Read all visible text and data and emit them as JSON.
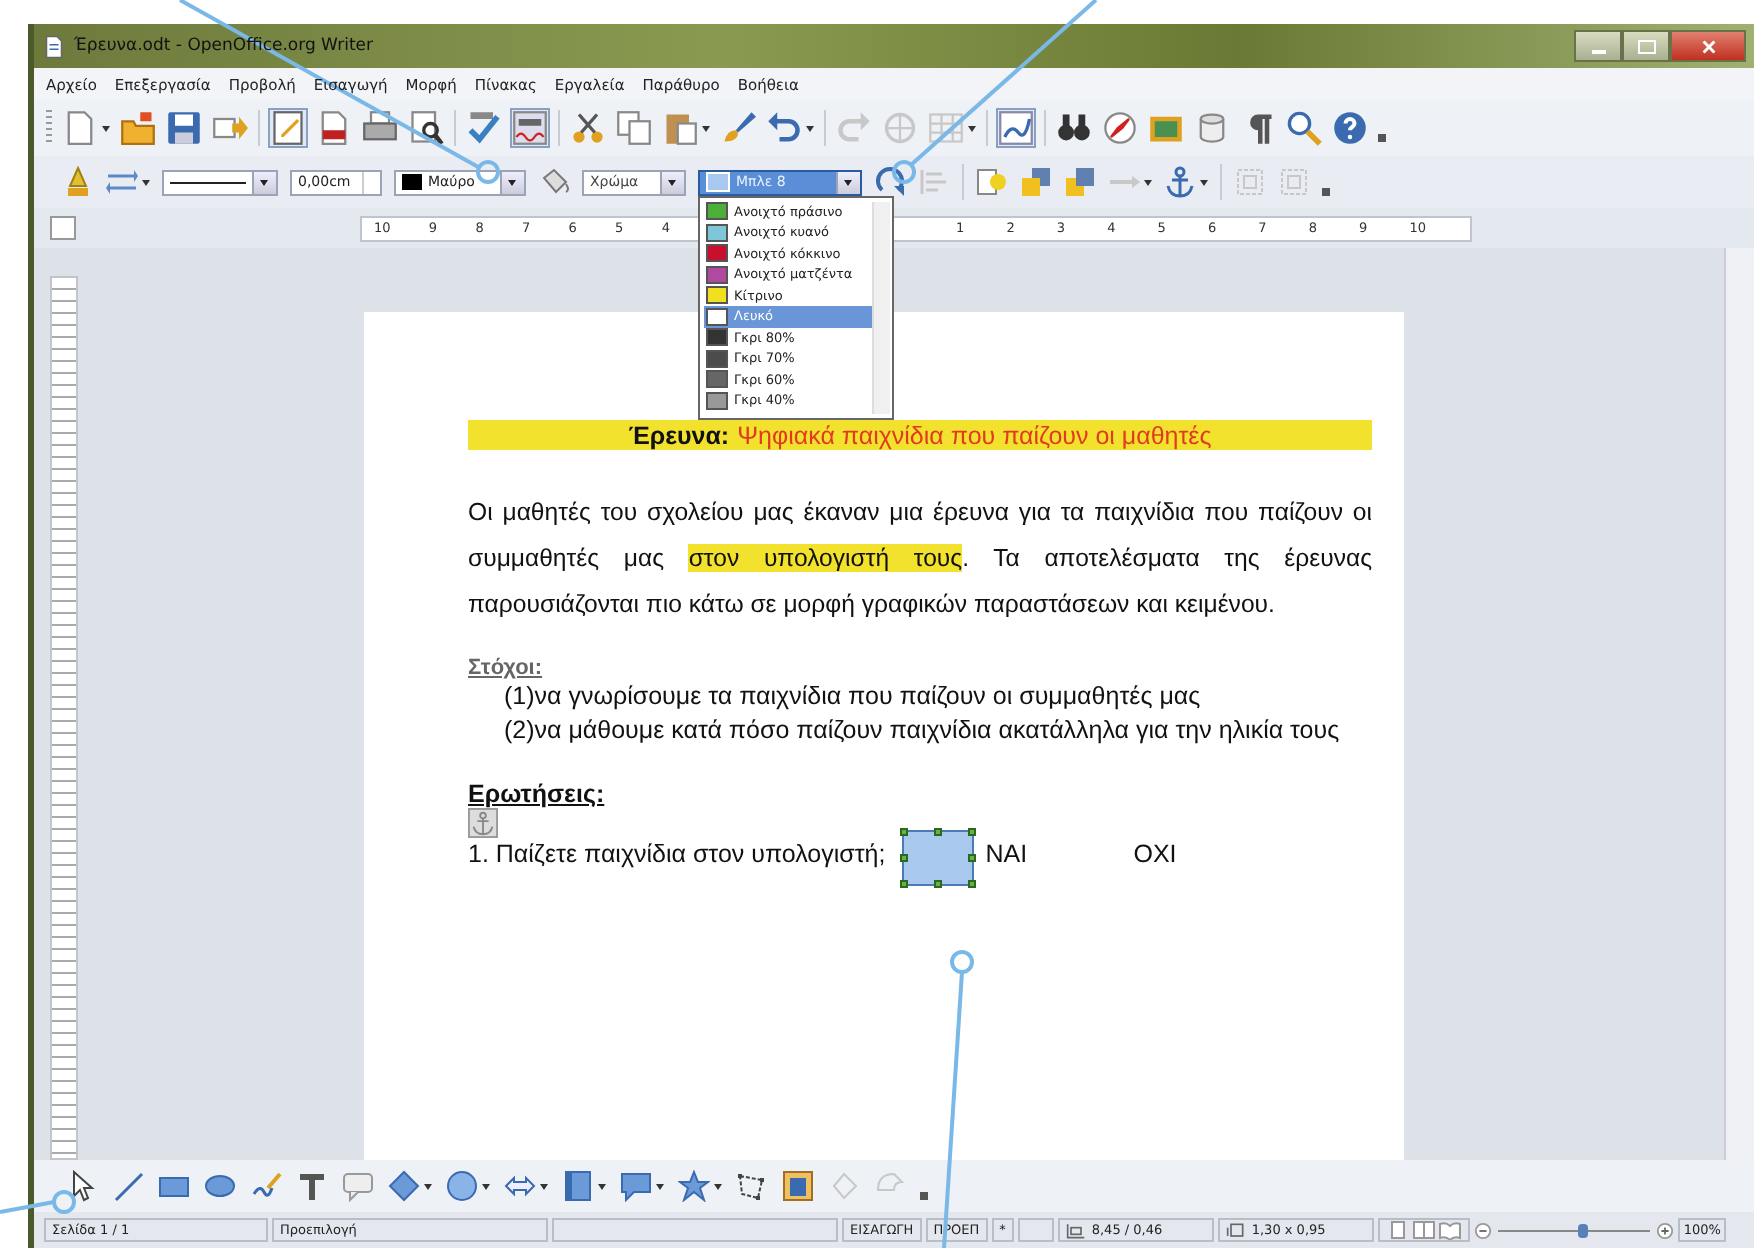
{
  "window": {
    "title": "Έρευνα.odt - OpenOffice.org Writer"
  },
  "menu": [
    "Αρχείο",
    "Επεξεργασία",
    "Προβολή",
    "Εισαγωγή",
    "Μορφή",
    "Πίνακας",
    "Εργαλεία",
    "Παράθυρο",
    "Βοήθεια"
  ],
  "drawing_properties": {
    "line_width": "0,00cm",
    "line_color": "Μαύρο",
    "area_style": "Χρώμα",
    "area_color": "Μπλε 8",
    "area_color_expanded": true
  },
  "color_list": [
    {
      "label": "Ανοιχτό πράσινο",
      "color": "#4caf3a",
      "selected": false
    },
    {
      "label": "Ανοιχτό κυανό",
      "color": "#7fc6d8",
      "selected": false
    },
    {
      "label": "Ανοιχτό κόκκινο",
      "color": "#c8102e",
      "selected": false
    },
    {
      "label": "Ανοιχτό ματζέντα",
      "color": "#b04aa0",
      "selected": false
    },
    {
      "label": "Κίτρινο",
      "color": "#f0e020",
      "selected": false
    },
    {
      "label": "Λευκό",
      "color": "#ffffff",
      "selected": true
    },
    {
      "label": "Γκρι 80%",
      "color": "#333333",
      "selected": false
    },
    {
      "label": "Γκρι 70%",
      "color": "#4c4c4c",
      "selected": false
    },
    {
      "label": "Γκρι 60%",
      "color": "#666666",
      "selected": false
    },
    {
      "label": "Γκρι 40%",
      "color": "#999999",
      "selected": false
    }
  ],
  "ruler": {
    "left_labels": [
      "10",
      "9",
      "8",
      "7",
      "6",
      "5",
      "4"
    ],
    "right_labels": [
      "1",
      "2",
      "3",
      "4",
      "5",
      "6",
      "7",
      "8",
      "9",
      "10"
    ]
  },
  "document": {
    "heading": {
      "label": "Έρευνα:",
      "title": "Ψηφιακά παιχνίδια που παίζουν οι μαθητές"
    },
    "paragraph": [
      {
        "text": "Οι μαθητές του σχολείου μας έκαναν μια έρευνα για τα παιχνίδια που παίζουν οι συμμαθητές μας ",
        "highlighted": false
      },
      {
        "text": "στον υπολογιστή τους",
        "highlighted": true
      },
      {
        "text": ". Τα αποτελέσματα της έρευνας παρουσιάζονται πιο κάτω σε μορφή γραφικών παραστάσεων και κειμένου.",
        "highlighted": false
      }
    ],
    "goals_heading": "Στόχοι:",
    "goals": [
      "(1)να γνωρίσουμε τα παιχνίδια που παίζουν οι συμμαθητές μας",
      "(2)να μάθουμε κατά πόσο παίζουν παιχνίδια ακατάλληλα για την ηλικία τους"
    ],
    "questions_heading": "Ερωτήσεις:",
    "question": {
      "text": "1. Παίζετε παιχνίδια στον υπολογιστή;",
      "options": [
        "ΝΑΙ",
        "ΟΧΙ"
      ]
    }
  },
  "status_bar": {
    "page": "Σελίδα 1 / 1",
    "style": "Προεπιλογή",
    "insert_mode": "ΕΙΣΑΓΩΓΗ",
    "selection_mode": "ΠΡΟΕΠ",
    "modified": "*",
    "position": "8,45 / 0,46",
    "size": "1,30 x 0,95",
    "zoom": {
      "level": 0.55,
      "reading": "100%"
    }
  }
}
